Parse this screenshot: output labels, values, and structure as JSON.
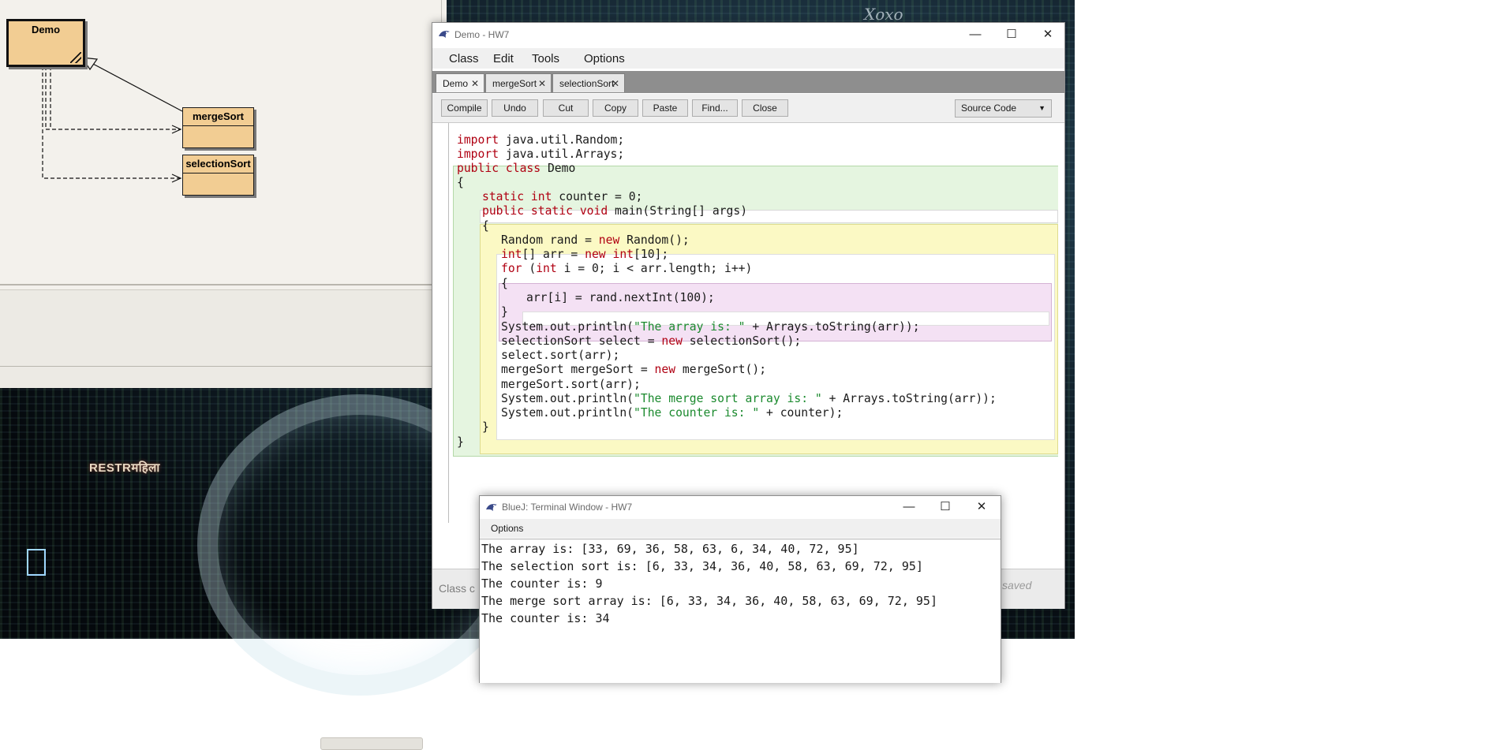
{
  "wallpaper": {
    "sign_left": "RESTRमहिला",
    "sign_top": "Xoxo"
  },
  "class_diagram": {
    "classes": [
      "Demo",
      "mergeSort",
      "selectionSort"
    ],
    "colors": {
      "class_fill": "#f2cd93",
      "background": "#f3f1ec"
    }
  },
  "editor": {
    "title": "Demo - HW7",
    "menu": [
      "Class",
      "Edit",
      "Tools",
      "Options"
    ],
    "tabs": [
      "Demo",
      "mergeSort",
      "selectionSort"
    ],
    "active_tab": "Demo",
    "toolbar": [
      "Compile",
      "Undo",
      "Cut",
      "Copy",
      "Paste",
      "Find...",
      "Close"
    ],
    "view_select": "Source Code",
    "code_lines": [
      "import java.util.Random;",
      "import java.util.Arrays;",
      "public class Demo",
      "{",
      "static int counter = 0;",
      "public static void main(String[] args)",
      "{",
      "Random rand = new Random();",
      "int[] arr = new int[10];",
      "for (int i = 0; i < arr.length; i++)",
      "{",
      "arr[i] = rand.nextInt(100);",
      "}",
      "System.out.println(\"The array is: \" + Arrays.toString(arr));",
      "selectionSort select = new selectionSort();",
      "select.sort(arr);",
      "mergeSort mergeSort = new mergeSort();",
      "mergeSort.sort(arr);",
      "System.out.println(\"The merge sort array is: \" + Arrays.toString(arr));",
      "System.out.println(\"The counter is: \" + counter);",
      "}",
      "}"
    ],
    "status_text": "Class c",
    "saved_label": "saved",
    "colors": {
      "keyword": "#b00012",
      "string": "#1b8a2e",
      "class_scope": "#e5f5e0",
      "method_scope": "#fbf9c4",
      "loop_scope": "#f4e1f4"
    }
  },
  "terminal": {
    "title": "BlueJ: Terminal Window - HW7",
    "menu": [
      "Options"
    ],
    "lines": [
      "The array is: [33, 69, 36, 58, 63, 6, 34, 40, 72, 95]",
      "The selection sort is: [6, 33, 34, 36, 40, 58, 63, 69, 72, 95]",
      "The counter is: 9",
      "The merge sort array is: [6, 33, 34, 36, 40, 58, 63, 69, 72, 95]",
      "The counter is: 34"
    ]
  },
  "window_controls": {
    "minimize": "—",
    "maximize": "☐",
    "close": "✕"
  }
}
